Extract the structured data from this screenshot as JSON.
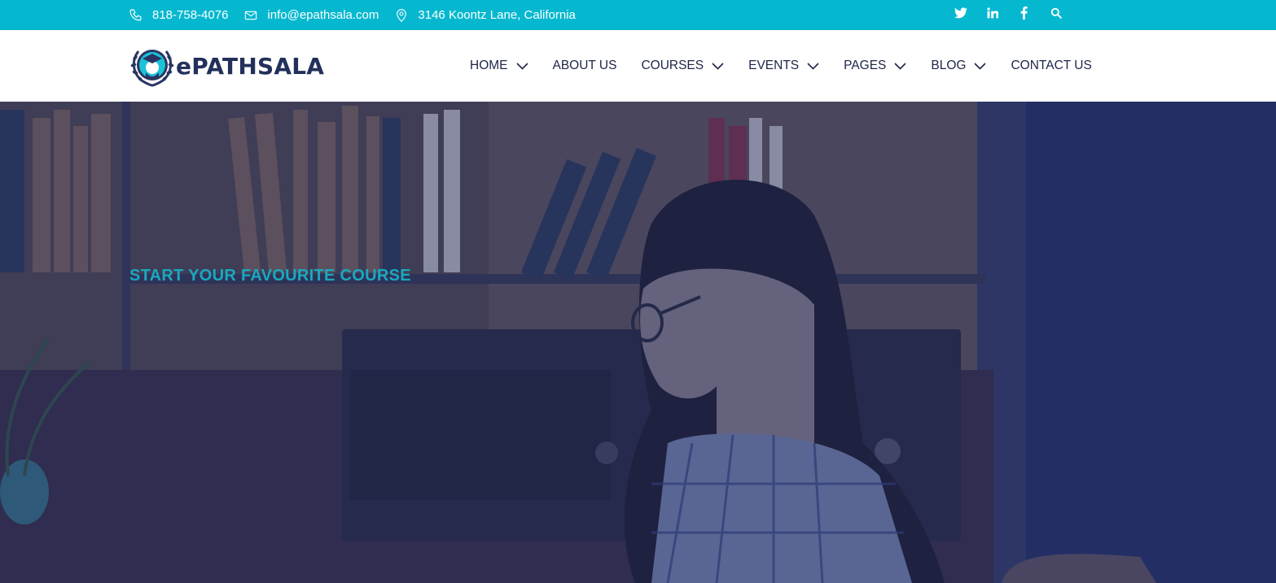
{
  "topbar": {
    "phone": "818-758-4076",
    "email": "info@epathsala.com",
    "address": "3146 Koontz Lane, California",
    "icons": [
      "phone-icon",
      "mail-icon",
      "location-pin-icon"
    ],
    "social": [
      "twitter-icon",
      "linkedin-icon",
      "facebook-icon",
      "search-icon"
    ]
  },
  "header": {
    "logo_text": "ePATHSALA",
    "nav": [
      {
        "label": "HOME",
        "dropdown": true
      },
      {
        "label": "ABOUT US",
        "dropdown": false
      },
      {
        "label": "COURSES",
        "dropdown": true
      },
      {
        "label": "EVENTS",
        "dropdown": true
      },
      {
        "label": "PAGES",
        "dropdown": true
      },
      {
        "label": "BLOG",
        "dropdown": true
      },
      {
        "label": "CONTACT US",
        "dropdown": false
      }
    ]
  },
  "hero": {
    "subtitle": "START YOUR FAVOURITE COURSE"
  },
  "colors": {
    "topbar": "#06b8cf",
    "nav_text": "#1e2448",
    "logo": "#23305a",
    "accent": "#1aa9bf"
  }
}
